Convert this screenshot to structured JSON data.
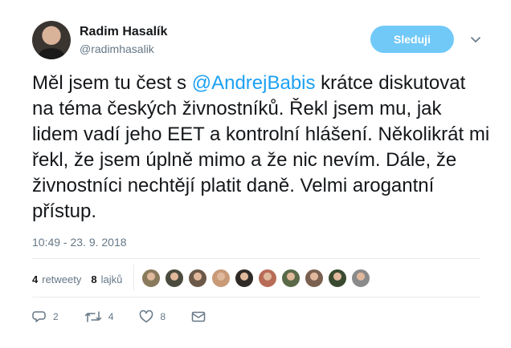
{
  "author": {
    "name": "Radim Hasalík",
    "handle": "@radimhasalik",
    "avatar_icon": "profile-photo"
  },
  "header": {
    "follow_label": "Sleduji",
    "menu_icon": "chevron-down-icon",
    "follow_color": "#71c9f8"
  },
  "tweet": {
    "text_before": "Měl jsem tu čest s ",
    "mention": "@AndrejBabis",
    "text_after": " krátce diskutovat na téma českých živnostníků. Řekl jsem mu, jak lidem vadí jeho EET a kontrolní hlášení. Několikrát mi řekl, že jsem úplně mimo a že nic nevím. Dále, že živnostníci nechtějí platit daně. Velmi arogantní přístup.",
    "mention_color": "#1da1f2",
    "timestamp": "10:49 - 23. 9. 2018"
  },
  "stats": {
    "retweets_count": "4",
    "retweets_label": "retweety",
    "likes_count": "8",
    "likes_label": "lajků"
  },
  "likers": [
    {
      "color": "#8a7a5c"
    },
    {
      "color": "#4a4a3e"
    },
    {
      "color": "#6b5848"
    },
    {
      "color": "#c89a78"
    },
    {
      "color": "#2f2a26"
    },
    {
      "color": "#b86c58"
    },
    {
      "color": "#5a6a48"
    },
    {
      "color": "#7a6050"
    },
    {
      "color": "#3a4a30"
    },
    {
      "color": "#8a8a8a"
    }
  ],
  "actions": {
    "reply_count": "2",
    "retweet_count": "4",
    "like_count": "8",
    "reply_icon": "reply-icon",
    "retweet_icon": "retweet-icon",
    "like_icon": "heart-icon",
    "dm_icon": "envelope-icon"
  }
}
